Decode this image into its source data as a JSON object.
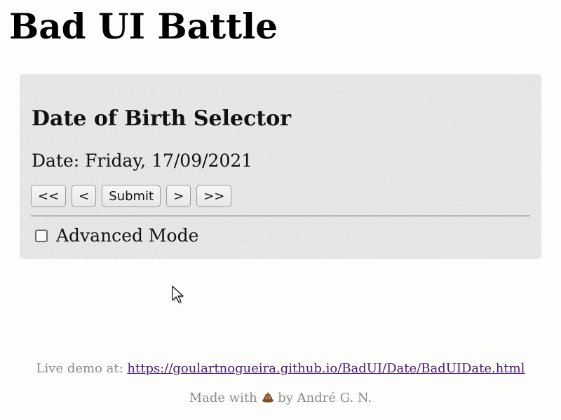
{
  "page": {
    "title": "Bad UI Battle"
  },
  "panel": {
    "title": "Date of Birth Selector",
    "date_label": "Date:",
    "date_value": "Friday, 17/09/2021",
    "buttons": {
      "prev_year": "<<",
      "prev_day": "<",
      "submit": "Submit",
      "next_day": ">",
      "next_year": ">>"
    },
    "advanced_mode": {
      "label": "Advanced Mode",
      "checked": false
    }
  },
  "footer": {
    "live_demo_label": "Live demo at:",
    "live_demo_link": "https://goulartnogueira.github.io/BadUI/Date/BadUIDate.html",
    "made_with_prefix": "Made with",
    "made_with_icon": "poop-emoji-icon",
    "made_with_suffix": "by André G. N."
  },
  "colors": {
    "panel_bg": "#e5e5e5",
    "link": "#4b1a72",
    "muted_text": "#8a8a8a"
  }
}
